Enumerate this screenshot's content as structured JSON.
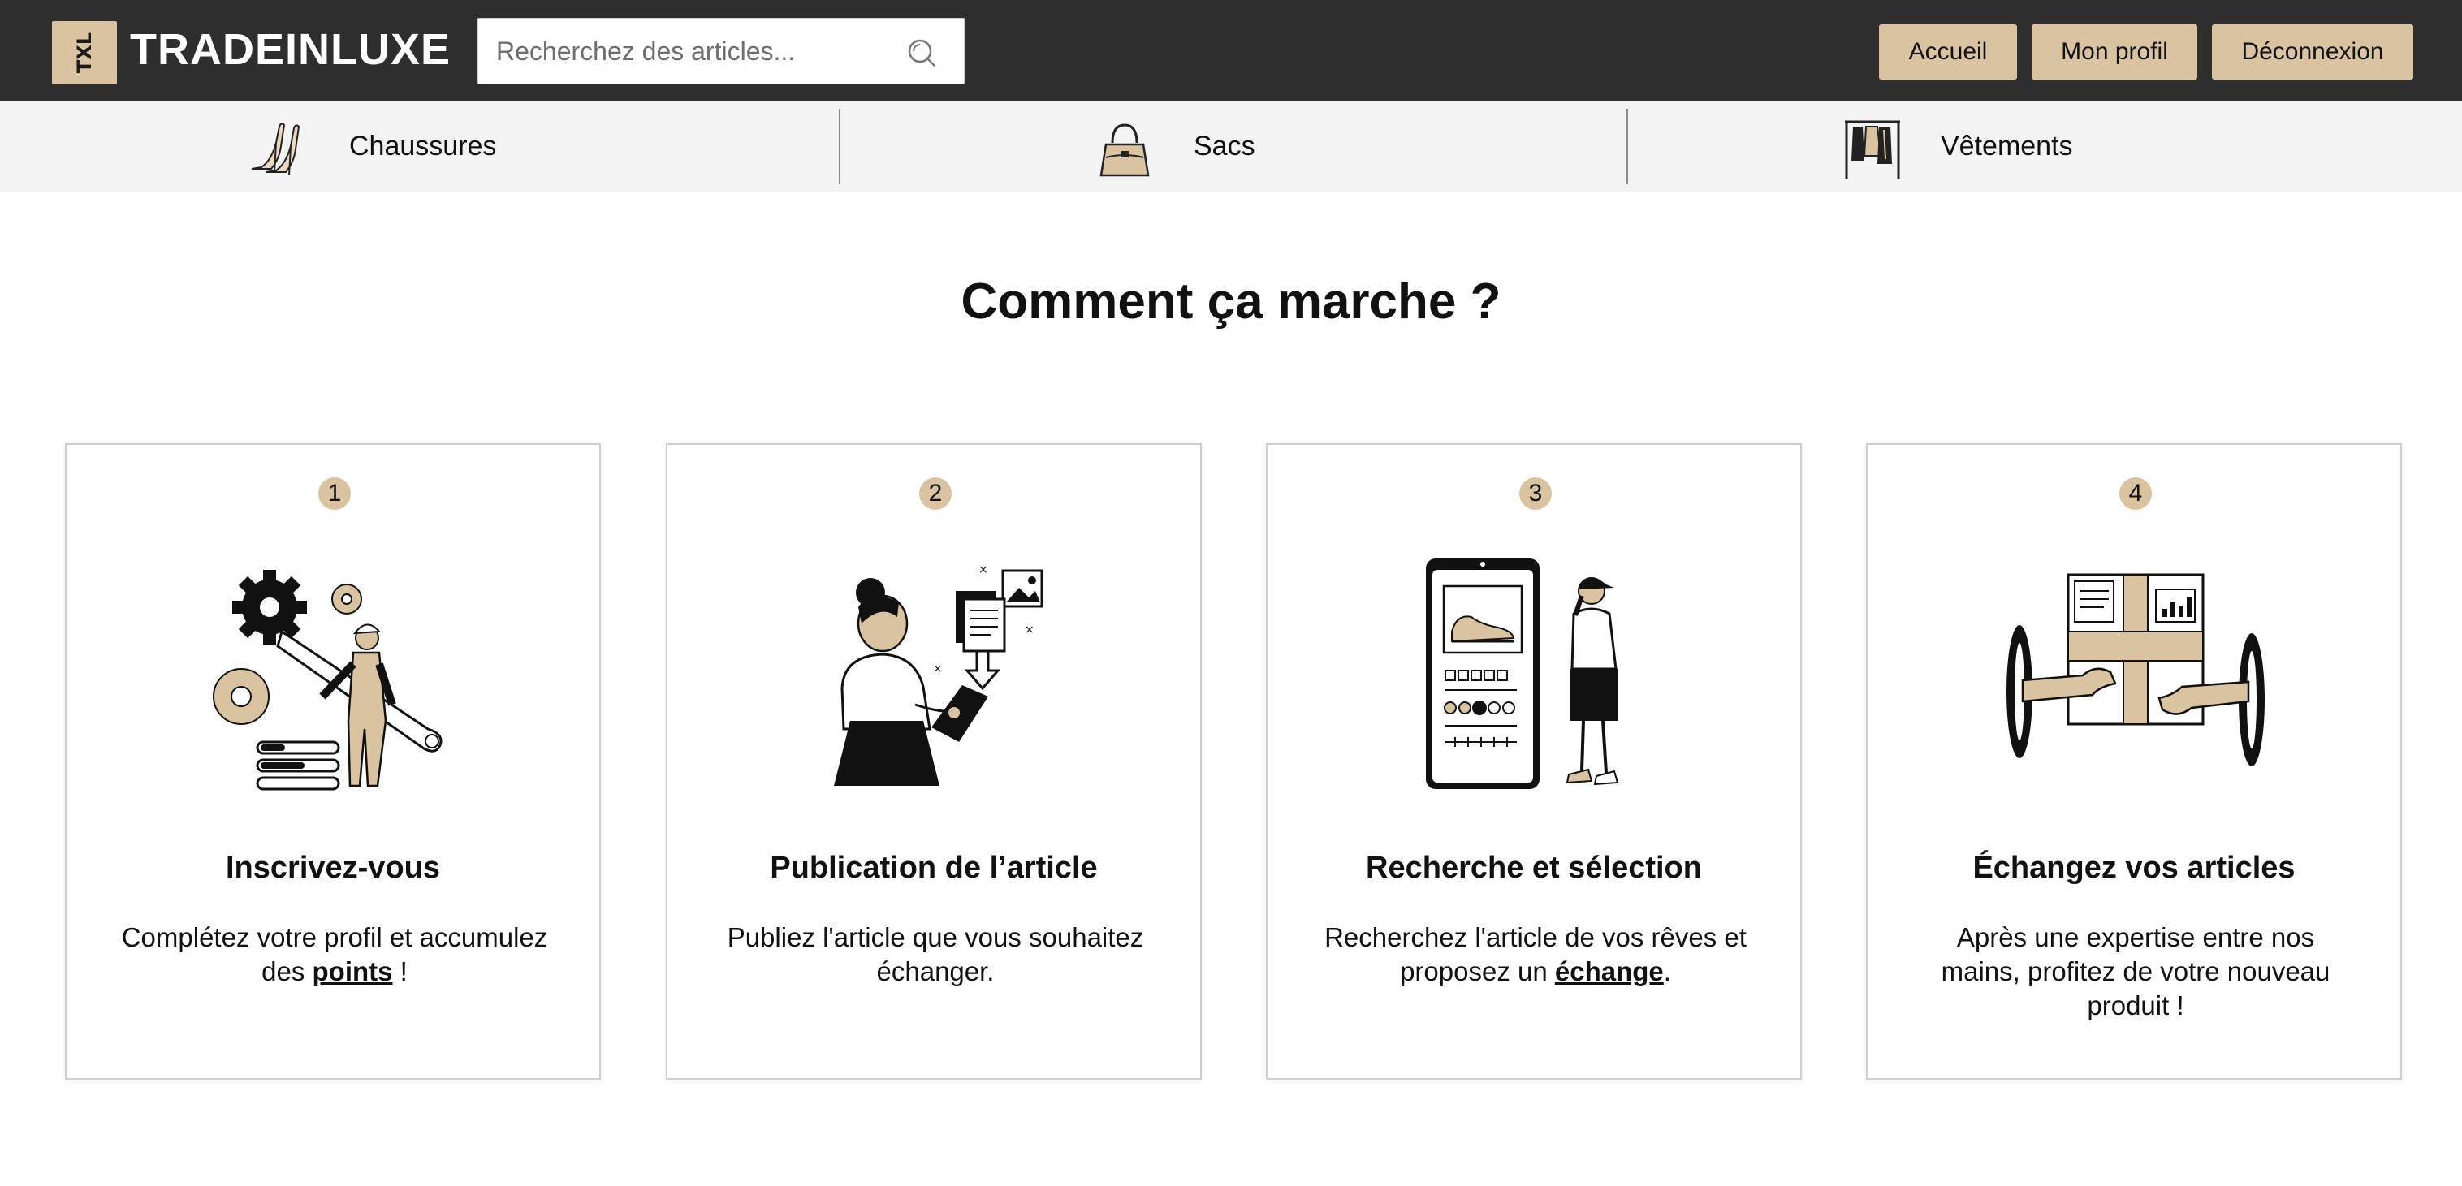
{
  "header": {
    "logo_mark": "TXL",
    "brand": "TRADEINLUXE",
    "search_placeholder": "Recherchez des articles...",
    "nav": {
      "home": "Accueil",
      "profile": "Mon profil",
      "logout": "Déconnexion"
    }
  },
  "categories": [
    {
      "label": "Chaussures",
      "icon": "heels-icon"
    },
    {
      "label": "Sacs",
      "icon": "handbag-icon"
    },
    {
      "label": "Vêtements",
      "icon": "clothes-rack-icon"
    }
  ],
  "main": {
    "title": "Comment ça marche ?",
    "steps": [
      {
        "number": "1",
        "title": "Inscrivez-vous",
        "text_before": "Complétez votre profil et accumulez des ",
        "link": "points",
        "text_after": " !",
        "illustration": "worker-with-gears-illustration"
      },
      {
        "number": "2",
        "title": "Publication de l’article",
        "text_before": "Publiez l'article que vous souhaitez échanger.",
        "link": "",
        "text_after": "",
        "illustration": "woman-uploading-illustration"
      },
      {
        "number": "3",
        "title": "Recherche et sélection",
        "text_before": "Recherchez l'article de vos rêves et proposez un ",
        "link": "échange",
        "text_after": ".",
        "illustration": "man-phone-shoe-illustration"
      },
      {
        "number": "4",
        "title": "Échangez vos articles",
        "text_before": "Après une expertise entre nos mains, profitez de votre nouveau produit !",
        "link": "",
        "text_after": "",
        "illustration": "hands-exchange-box-illustration"
      }
    ]
  },
  "colors": {
    "header_bg": "#2e2e2e",
    "accent": "#d9c3a1",
    "category_bar_bg": "#f3f3f3"
  }
}
